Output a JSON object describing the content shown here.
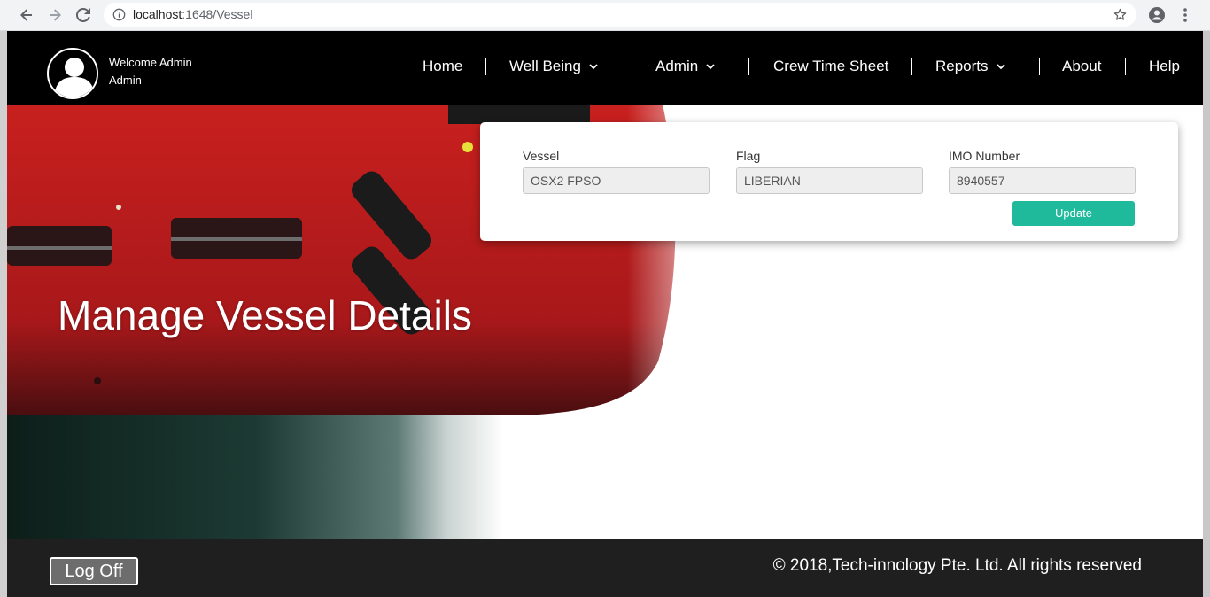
{
  "browser": {
    "url_host": "localhost",
    "url_path": ":1648/Vessel"
  },
  "header": {
    "welcome_line1": "Welcome Admin",
    "welcome_line2": "Admin",
    "nav": {
      "home": "Home",
      "well_being": "Well Being",
      "admin": "Admin",
      "crew_time_sheet": "Crew Time Sheet",
      "reports": "Reports",
      "about": "About",
      "help": "Help"
    }
  },
  "hero": {
    "title": "Manage Vessel Details"
  },
  "form": {
    "vessel": {
      "label": "Vessel",
      "value": "OSX2 FPSO"
    },
    "flag": {
      "label": "Flag",
      "value": "LIBERIAN"
    },
    "imo": {
      "label": "IMO Number",
      "value": "8940557"
    },
    "update_label": "Update"
  },
  "footer": {
    "logoff_label": "Log Off",
    "copyright": "© 2018,Tech-innology Pte. Ltd. All rights reserved"
  },
  "colors": {
    "accent": "#1fb99b",
    "header_bg": "#000000",
    "footer_bg": "#1f1f1f",
    "hull_red": "#c8201e"
  },
  "icons": {
    "back": "back-arrow-icon",
    "forward": "forward-arrow-icon",
    "reload": "reload-icon",
    "info": "info-icon",
    "star": "bookmark-star-icon",
    "account": "account-icon",
    "menu": "kebab-menu-icon",
    "avatar": "user-avatar-icon",
    "chevron": "chevron-down-icon"
  }
}
